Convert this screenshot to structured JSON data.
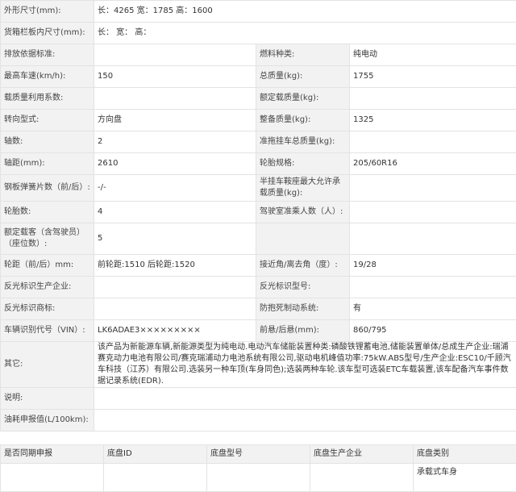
{
  "spec": [
    {
      "type": "full",
      "label": "外形尺寸(mm):",
      "value": "长：4265 宽：1785 高：1600"
    },
    {
      "type": "full",
      "label": "货箱栏板内尺寸(mm):",
      "value": "长： 宽： 高："
    },
    {
      "type": "pair",
      "label1": "排放依据标准:",
      "value1": "",
      "label2": "燃料种类:",
      "value2": "纯电动"
    },
    {
      "type": "pair",
      "label1": "最高车速(km/h):",
      "value1": "150",
      "label2": "总质量(kg):",
      "value2": "1755"
    },
    {
      "type": "pair",
      "label1": "载质量利用系数:",
      "value1": "",
      "label2": "额定载质量(kg):",
      "value2": ""
    },
    {
      "type": "pair",
      "label1": "转向型式:",
      "value1": "方向盘",
      "label2": "整备质量(kg):",
      "value2": "1325"
    },
    {
      "type": "pair",
      "label1": "轴数:",
      "value1": "2",
      "label2": "准拖挂车总质量(kg):",
      "value2": ""
    },
    {
      "type": "pair",
      "label1": "轴距(mm):",
      "value1": "2610",
      "label2": "轮胎规格:",
      "value2": "205/60R16"
    },
    {
      "type": "pair",
      "label1": "钢板弹簧片数（前/后）:",
      "value1": "-/-",
      "label2": "半挂车鞍座最大允许承载质量(kg):",
      "value2": ""
    },
    {
      "type": "pair",
      "label1": "轮胎数:",
      "value1": "4",
      "label2": "驾驶室准乘人数（人）:",
      "value2": ""
    },
    {
      "type": "pair",
      "label1": "额定载客（含驾驶员）（座位数）:",
      "value1": "5",
      "label2": "",
      "value2": ""
    },
    {
      "type": "pair",
      "label1": "轮距（前/后）mm:",
      "value1": "前轮距:1510 后轮距:1520",
      "label2": "接近角/离去角（度）:",
      "value2": "19/28"
    },
    {
      "type": "pair",
      "label1": "反光标识生产企业:",
      "value1": "",
      "label2": "反光标识型号:",
      "value2": ""
    },
    {
      "type": "pair",
      "label1": "反光标识商标:",
      "value1": "",
      "label2": "防抱死制动系统:",
      "value2": "有"
    },
    {
      "type": "pair",
      "label1": "车辆识别代号（VIN）:",
      "value1": "LK6ADAE3×××××××××",
      "label2": "前悬/后悬(mm):",
      "value2": "860/795"
    },
    {
      "type": "full",
      "label": "其它:",
      "value": "该产品为新能源车辆,新能源类型为纯电动.电动汽车储能装置种类:磷酸铁锂蓄电池,储能装置单体/总成生产企业:瑞浦赛克动力电池有限公司/赛克瑞浦动力电池系统有限公司,驱动电机峰值功率:75kW.ABS型号/生产企业:ESC10/千顾汽车科技（江苏）有限公司.选装另一种车顶(车身同色);选装两种车轮.该车型可选装ETC车载装置,该车配备汽车事件数据记录系统(EDR)."
    },
    {
      "type": "full",
      "label": "说明:",
      "value": ""
    },
    {
      "type": "full",
      "label": "油耗申报值(L/100km):",
      "value": ""
    }
  ],
  "chassis": {
    "headers": [
      "是否同期申报",
      "底盘ID",
      "底盘型号",
      "底盘生产企业",
      "底盘类别"
    ],
    "row": [
      "",
      "",
      "",
      "",
      "承载式车身"
    ]
  }
}
